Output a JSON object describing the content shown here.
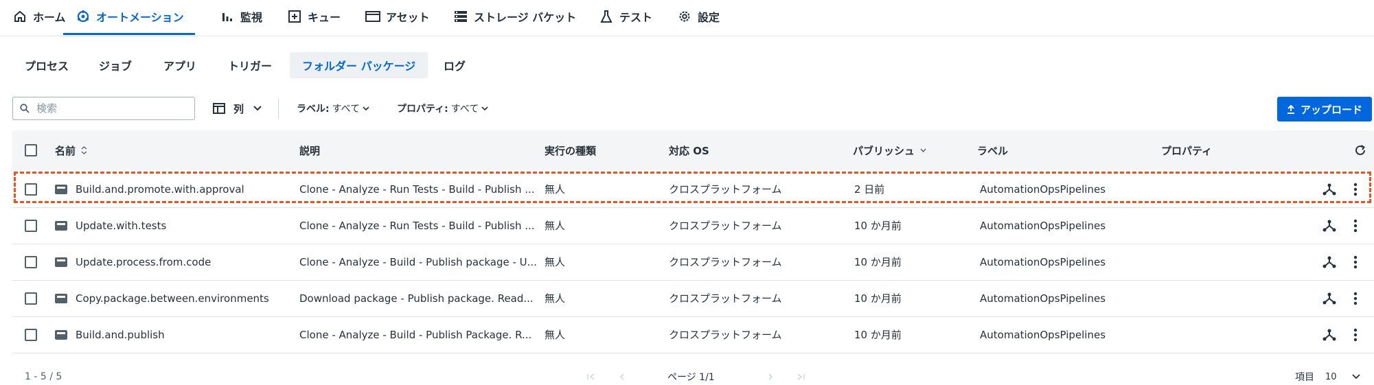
{
  "topnav": {
    "items": [
      {
        "label": "ホーム",
        "icon": "home-icon"
      },
      {
        "label": "オートメーション",
        "icon": "automation-icon"
      },
      {
        "label": "監視",
        "icon": "bar-chart-icon"
      },
      {
        "label": "キュー",
        "icon": "queue-icon"
      },
      {
        "label": "アセット",
        "icon": "asset-icon"
      },
      {
        "label": "ストレージ バケット",
        "icon": "storage-icon"
      },
      {
        "label": "テスト",
        "icon": "flask-icon"
      },
      {
        "label": "設定",
        "icon": "gear-icon"
      }
    ],
    "active": "オートメーション"
  },
  "subtabs": {
    "items": [
      "プロセス",
      "ジョブ",
      "アプリ",
      "トリガー",
      "フォルダー パッケージ",
      "ログ"
    ],
    "active": "フォルダー パッケージ"
  },
  "toolbar": {
    "search_placeholder": "検索",
    "columns_label": "列",
    "label_filter_name": "ラベル:",
    "label_filter_value": "すべて",
    "property_filter_name": "プロパティ:",
    "property_filter_value": "すべて",
    "upload_label": "アップロード"
  },
  "table": {
    "headers": {
      "name": "名前",
      "description": "説明",
      "execution_type": "実行の種類",
      "os": "対応 OS",
      "published": "パブリッシュ",
      "labels": "ラベル",
      "properties": "プロパティ"
    },
    "rows": [
      {
        "name": "Build.and.promote.with.approval",
        "description": "Clone - Analyze - Run Tests - Build - Publish ...",
        "execution_type": "無人",
        "os": "クロスプラットフォーム",
        "published": "2 日前",
        "labels": "AutomationOpsPipelines",
        "properties": ""
      },
      {
        "name": "Update.with.tests",
        "description": "Clone - Analyze - Run Tests - Build - Publish ...",
        "execution_type": "無人",
        "os": "クロスプラットフォーム",
        "published": "10 か月前",
        "labels": "AutomationOpsPipelines",
        "properties": ""
      },
      {
        "name": "Update.process.from.code",
        "description": "Clone - Analyze - Build - Publish package - U...",
        "execution_type": "無人",
        "os": "クロスプラットフォーム",
        "published": "10 か月前",
        "labels": "AutomationOpsPipelines",
        "properties": ""
      },
      {
        "name": "Copy.package.between.environments",
        "description": "Download package - Publish package. Read...",
        "execution_type": "無人",
        "os": "クロスプラットフォーム",
        "published": "10 か月前",
        "labels": "AutomationOpsPipelines",
        "properties": ""
      },
      {
        "name": "Build.and.publish",
        "description": "Clone - Analyze - Build - Publish Package. R...",
        "execution_type": "無人",
        "os": "クロスプラットフォーム",
        "published": "10 か月前",
        "labels": "AutomationOpsPipelines",
        "properties": ""
      }
    ]
  },
  "footer": {
    "range": "1 - 5 / 5",
    "page": "ページ 1/1",
    "items_label": "項目",
    "items_per_page": "10"
  },
  "colors": {
    "accent": "#0067df",
    "highlight": "#e8541c"
  }
}
